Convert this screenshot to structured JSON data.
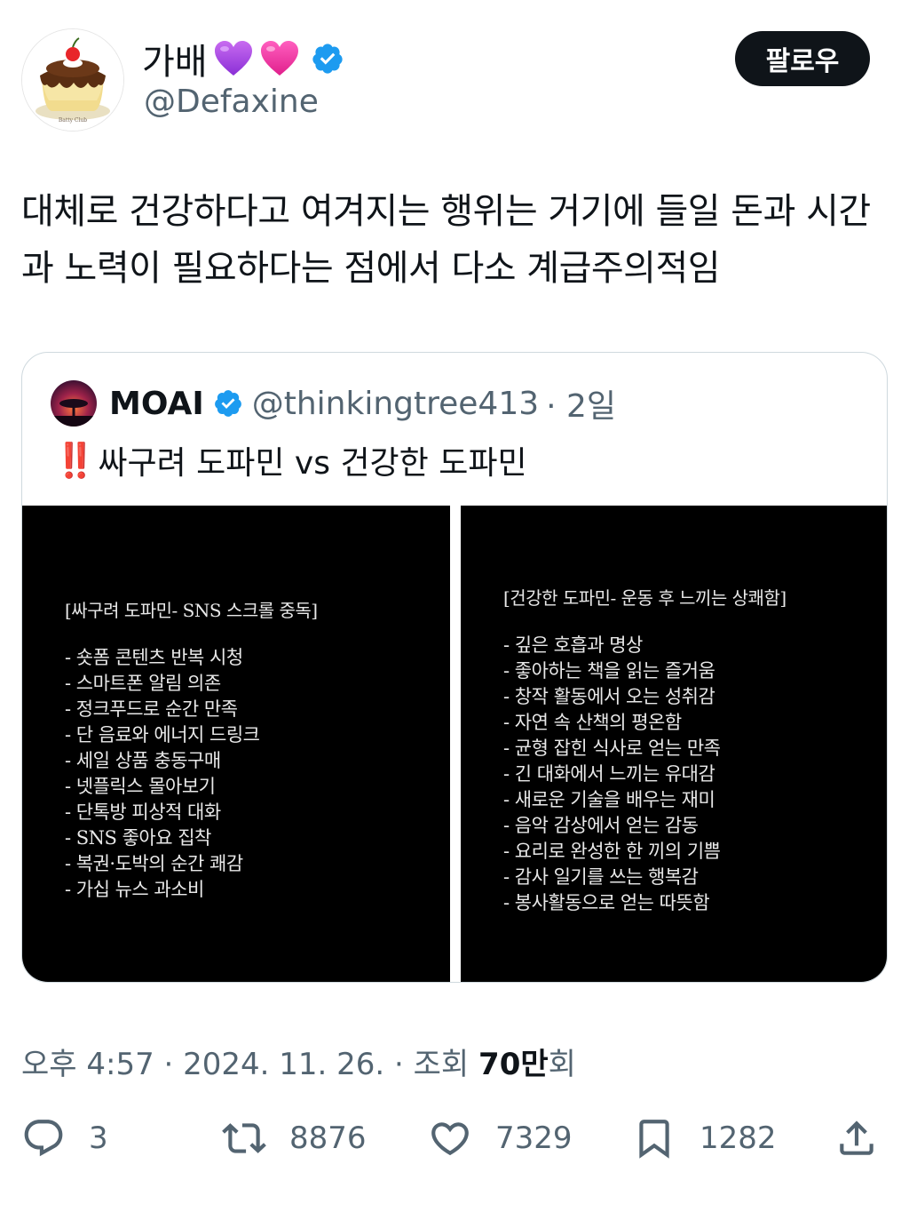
{
  "author": {
    "display_name": "가배",
    "handle": "@Defaxine",
    "verified": true,
    "emoji": [
      "purple-heart",
      "pink-heart"
    ],
    "avatar_text": "Batty Club"
  },
  "follow_button": {
    "label": "팔로우"
  },
  "tweet": {
    "text": "대체로 건강하다고 여겨지는 행위는 거기에 들일 돈과 시간과 노력이 필요하다는 점에서 다소 계급주의적임"
  },
  "quote": {
    "author_name": "MOAI",
    "handle": "@thinkingtree413",
    "time": "· 2일",
    "title_emoji": "‼️",
    "title": "싸구려 도파민 vs 건강한 도파민",
    "left_panel": {
      "title": "[싸구려 도파민- SNS 스크롤 중독]",
      "items": [
        "- 숏폼 콘텐츠 반복 시청",
        "- 스마트폰 알림 의존",
        "- 정크푸드로 순간 만족",
        "- 단 음료와 에너지 드링크",
        "- 세일 상품 충동구매",
        "- 넷플릭스 몰아보기",
        "- 단톡방 피상적 대화",
        "- SNS 좋아요 집착",
        "- 복권·도박의 순간 쾌감",
        "- 가십 뉴스 과소비"
      ]
    },
    "right_panel": {
      "title": "[건강한 도파민- 운동 후 느끼는 상쾌함]",
      "items": [
        "- 깊은 호흡과 명상",
        "- 좋아하는 책을 읽는 즐거움",
        "- 창작 활동에서 오는 성취감",
        "- 자연 속 산책의 평온함",
        "- 균형 잡힌 식사로 얻는 만족",
        "- 긴 대화에서 느끼는 유대감",
        "- 새로운 기술을 배우는 재미",
        "- 음악 감상에서 얻는 감동",
        "- 요리로 완성한 한 끼의 기쁨",
        "- 감사 일기를 쓰는 행복감",
        "- 봉사활동으로 얻는 따뜻함"
      ]
    }
  },
  "meta": {
    "timestamp": "오후 4:57 · 2024. 11. 26. · 조회 ",
    "views": "70만",
    "views_suffix": "회"
  },
  "actions": {
    "replies": "3",
    "retweets": "8876",
    "likes": "7329",
    "bookmarks": "1282"
  },
  "colors": {
    "text": "#0f1419",
    "secondary": "#536471",
    "verified": "#1d9bf0",
    "follow_bg": "#0f1419"
  }
}
